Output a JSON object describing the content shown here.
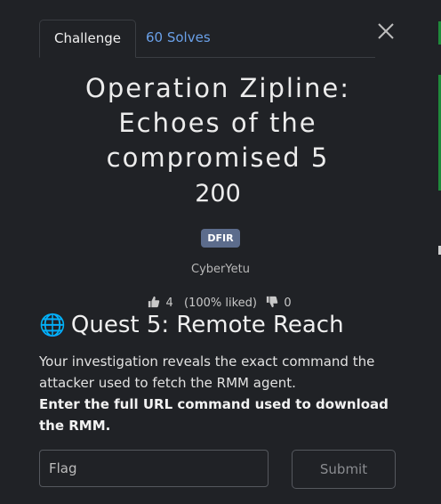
{
  "tabs": [
    {
      "label": "Challenge"
    },
    {
      "label": "60 Solves"
    }
  ],
  "challenge": {
    "title": "Operation Zipline: Echoes of the compromised 5",
    "points": "200",
    "category": "DFIR",
    "author": "CyberYetu"
  },
  "votes": {
    "likes": "4",
    "liked_text": "(100% liked)",
    "dislikes": "0"
  },
  "quest": {
    "heading": "Quest 5: Remote Reach",
    "description": "Your investigation reveals the exact command the attacker used to fetch the RMM agent.",
    "instruction": "Enter the full URL command used to download the RMM."
  },
  "form": {
    "flag_placeholder": "Flag",
    "submit_label": "Submit"
  },
  "colors": {
    "background": "#202226",
    "link": "#6aa0e8",
    "badge": "#5c6c8c"
  },
  "icons": [
    "close-icon",
    "globe-icon",
    "thumbs-up-icon",
    "thumbs-down-icon"
  ]
}
